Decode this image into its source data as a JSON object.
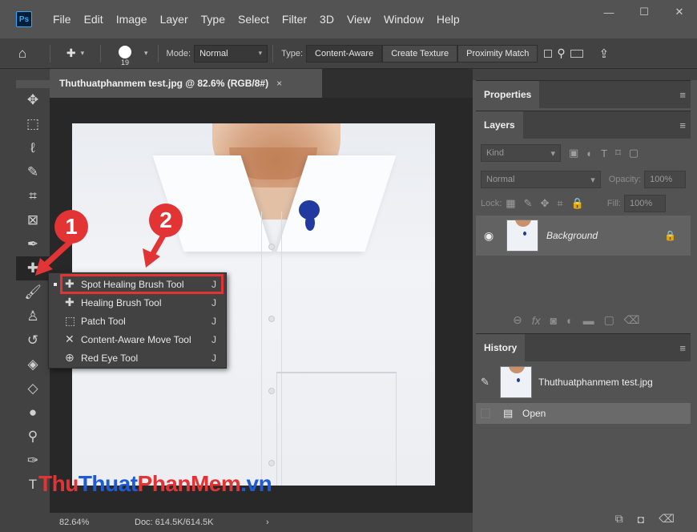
{
  "app": {
    "logo": "Ps"
  },
  "menu": [
    "File",
    "Edit",
    "Image",
    "Layer",
    "Type",
    "Select",
    "Filter",
    "3D",
    "View",
    "Window",
    "Help"
  ],
  "window_controls": {
    "minimize": "—",
    "restore": "☐",
    "close": "✕"
  },
  "options": {
    "brush_size": "19",
    "mode_label": "Mode:",
    "mode_value": "Normal",
    "type_label": "Type:",
    "type_options": [
      "Content-Aware",
      "Create Texture",
      "Proximity Match"
    ],
    "type_selected": "Content-Aware"
  },
  "document": {
    "tab_title": "Thuthuatphanmem test.jpg @ 82.6% (RGB/8#)",
    "close": "×",
    "zoom": "82.64%",
    "doc_size": "Doc: 614.5K/614.5K",
    "arrow": "›"
  },
  "tools": [
    {
      "icon": "move-icon",
      "glyph": "✥"
    },
    {
      "icon": "marquee-icon",
      "glyph": "⬚"
    },
    {
      "icon": "lasso-icon",
      "glyph": "ℓ"
    },
    {
      "icon": "quick-select-icon",
      "glyph": "✎"
    },
    {
      "icon": "crop-icon",
      "glyph": "⌗"
    },
    {
      "icon": "frame-icon",
      "glyph": "⊠"
    },
    {
      "icon": "eyedropper-icon",
      "glyph": "✒"
    },
    {
      "icon": "spot-healing-icon",
      "glyph": "✚"
    },
    {
      "icon": "brush-icon",
      "glyph": "🖌"
    },
    {
      "icon": "stamp-icon",
      "glyph": "♙"
    },
    {
      "icon": "history-brush-icon",
      "glyph": "↺"
    },
    {
      "icon": "eraser-icon",
      "glyph": "◈"
    },
    {
      "icon": "paint-bucket-icon",
      "glyph": "◇"
    },
    {
      "icon": "blur-icon",
      "glyph": "●"
    },
    {
      "icon": "dodge-icon",
      "glyph": "⚲"
    },
    {
      "icon": "pen-icon",
      "glyph": "✑"
    },
    {
      "icon": "type-icon",
      "glyph": "T"
    }
  ],
  "flyout": {
    "items": [
      {
        "label": "Spot Healing Brush Tool",
        "shortcut": "J",
        "icon": "spot-healing-icon",
        "glyph": "✚"
      },
      {
        "label": "Healing Brush Tool",
        "shortcut": "J",
        "icon": "healing-brush-icon",
        "glyph": "✚"
      },
      {
        "label": "Patch Tool",
        "shortcut": "J",
        "icon": "patch-icon",
        "glyph": "⬚"
      },
      {
        "label": "Content-Aware Move Tool",
        "shortcut": "J",
        "icon": "content-aware-move-icon",
        "glyph": "✕"
      },
      {
        "label": "Red Eye Tool",
        "shortcut": "J",
        "icon": "red-eye-icon",
        "glyph": "⊕"
      }
    ]
  },
  "annotations": {
    "badge1": "1",
    "badge2": "2",
    "color": "#e23434"
  },
  "watermark": {
    "part1": "Thu",
    "part2": "Thuat",
    "part3": "PhanMem",
    "part4": ".vn"
  },
  "properties_panel": {
    "title": "Properties",
    "menu": "≡"
  },
  "layers_panel": {
    "title": "Layers",
    "menu": "≡",
    "filter_placeholder": "Kind",
    "blend_mode": "Normal",
    "opacity_label": "Opacity:",
    "opacity_value": "100%",
    "lock_label": "Lock:",
    "fill_label": "Fill:",
    "fill_value": "100%",
    "layer_name": "Background",
    "footer_icons": [
      "link-icon",
      "fx-icon",
      "mask-icon",
      "adjustment-icon",
      "group-icon",
      "new-layer-icon",
      "trash-icon"
    ]
  },
  "history_panel": {
    "title": "History",
    "menu": "≡",
    "snapshot_name": "Thuthuatphanmem test.jpg",
    "states": [
      "Open"
    ]
  }
}
